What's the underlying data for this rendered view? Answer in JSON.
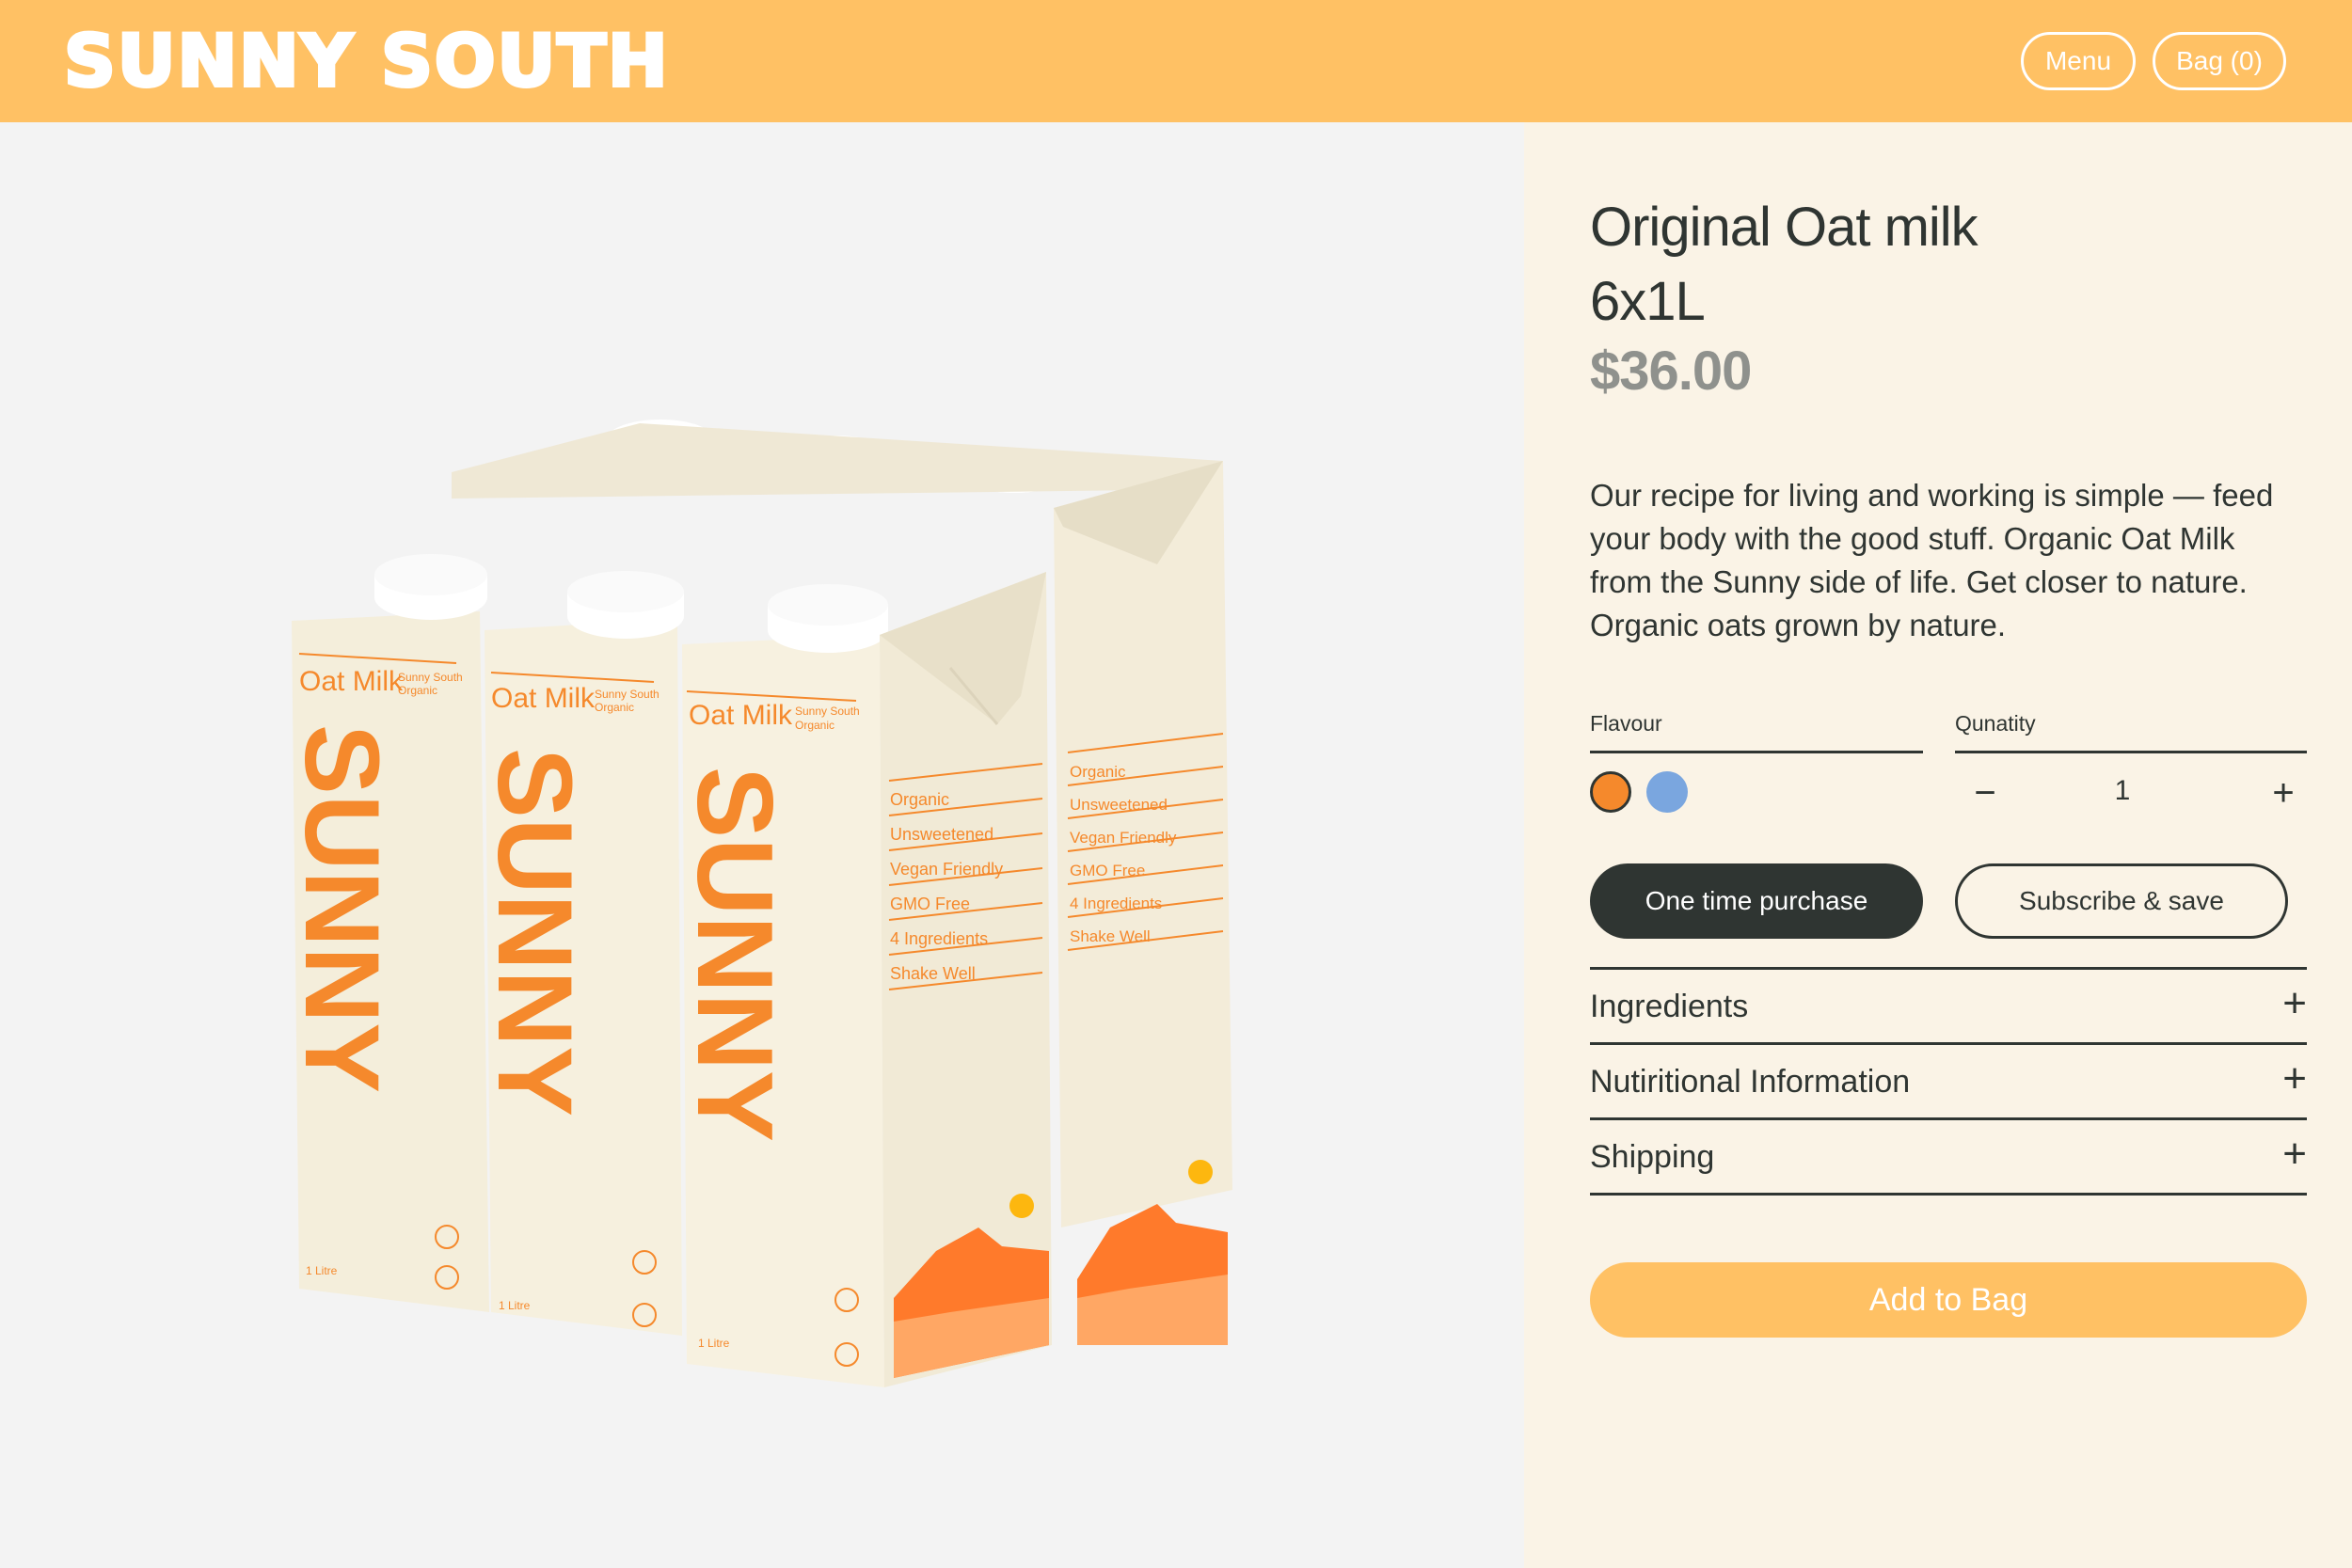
{
  "header": {
    "logo": "SUNNY SOUTH",
    "menu_label": "Menu",
    "bag_label": "Bag (0)"
  },
  "product": {
    "title_line1": "Original Oat milk",
    "title_line2": "6x1L",
    "price": "$36.00",
    "description": "Our recipe for living and working is simple — feed your body with the good stuff. Organic Oat Milk from the Sunny side of life. Get closer to nature. Organic oats grown by nature.",
    "image": {
      "icon": "oat-milk-cartons-image",
      "carton_name": "Oat Milk",
      "carton_brand_line1": "Sunny South",
      "carton_brand_line2": "Organic",
      "carton_wordmark": "SUNNY",
      "carton_volume": "1 Litre",
      "carton_features": [
        "Organic",
        "Unsweetened",
        "Vegan Friendly",
        "GMO Free",
        "4 Ingredients",
        "Shake Well"
      ]
    }
  },
  "options": {
    "flavour_label": "Flavour",
    "quantity_label": "Qunatity",
    "flavours": [
      {
        "name": "orange",
        "color": "#f5892c",
        "selected": true
      },
      {
        "name": "blue",
        "color": "#7aa6df",
        "selected": false
      }
    ],
    "quantity": "1",
    "decrement_symbol": "−",
    "increment_symbol": "+"
  },
  "purchase": {
    "one_time_label": "One time purchase",
    "subscribe_label": "Subscribe & save"
  },
  "accordion": [
    {
      "label": "Ingredients",
      "symbol": "+"
    },
    {
      "label": "Nutiritional Information",
      "symbol": "+"
    },
    {
      "label": "Shipping",
      "symbol": "+"
    }
  ],
  "add_to_bag_label": "Add to Bag",
  "colors": {
    "brand_yellow": "#ffc164",
    "dark": "#2f3532",
    "panel_bg": "#faf3e6",
    "carton_orange": "#f5892c"
  }
}
